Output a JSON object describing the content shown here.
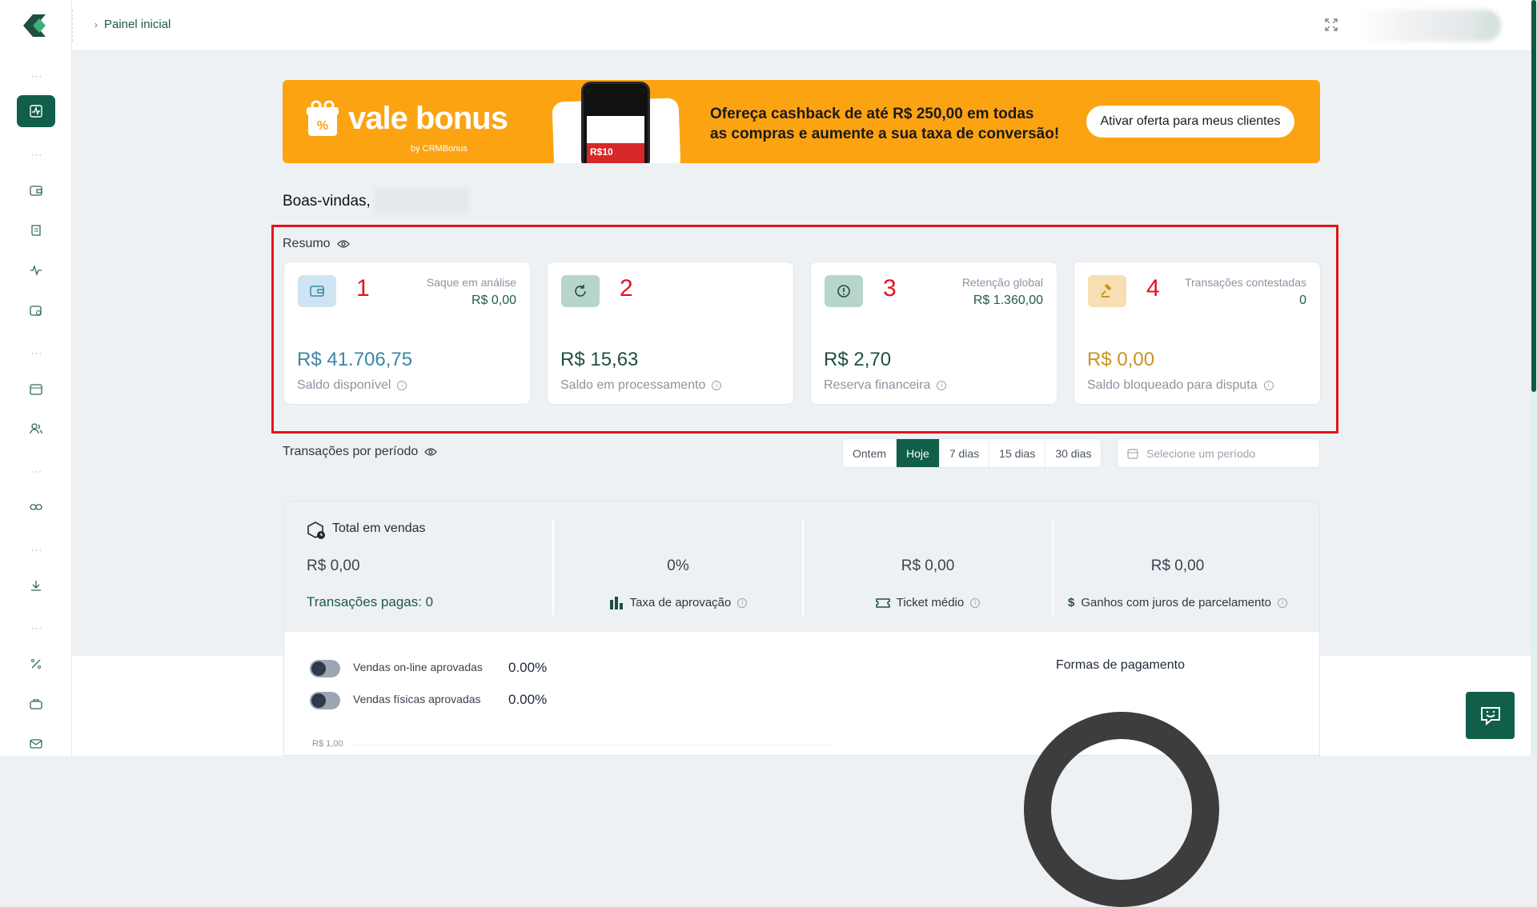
{
  "topbar": {
    "breadcrumb": "Painel inicial"
  },
  "banner": {
    "brand": "vale bonus",
    "brand_sub": "by CRMBonus",
    "phone_price": "R$10",
    "message_line1": "Ofereça cashback de até R$ 250,00 em todas",
    "message_line2": "as compras e aumente a sua taxa de conversão!",
    "cta": "Ativar oferta para meus clientes"
  },
  "welcome": {
    "text": "Boas-vindas,"
  },
  "resumo": {
    "title": "Resumo",
    "cards": [
      {
        "number": "1",
        "label": "Saque em análise",
        "sub": "R$ 0,00",
        "value": "R$ 41.706,75",
        "desc": "Saldo disponível",
        "value_color": "#3b86a8",
        "icon_bg": "#cfe4f2",
        "icon": "wallet-icon"
      },
      {
        "number": "2",
        "label": "",
        "sub": "",
        "value": "R$ 15,63",
        "desc": "Saldo em processamento",
        "value_color": "#1e4f40",
        "icon_bg": "#b7d6c9",
        "icon": "refresh-icon"
      },
      {
        "number": "3",
        "label": "Retenção global",
        "sub": "R$ 1.360,00",
        "value": "R$ 2,70",
        "desc": "Reserva financeira",
        "value_color": "#1e4f40",
        "icon_bg": "#b7d6c9",
        "icon": "alert-icon"
      },
      {
        "number": "4",
        "label": "Transações contestadas",
        "sub": "0",
        "value": "R$ 0,00",
        "desc": "Saldo bloqueado para disputa",
        "value_color": "#c9941c",
        "icon_bg": "#f6dfb2",
        "icon": "gavel-icon"
      }
    ]
  },
  "transactions": {
    "title": "Transações por período",
    "filters": [
      "Ontem",
      "Hoje",
      "7 dias",
      "15 dias",
      "30 dias"
    ],
    "active_filter": "Hoje",
    "date_placeholder": "Selecione um período"
  },
  "stats": {
    "total_title": "Total em vendas",
    "total_value": "R$ 0,00",
    "paid_transactions": "Transações pagas: 0",
    "approval_value": "0%",
    "approval_label": "Taxa de aprovação",
    "ticket_value": "R$ 0,00",
    "ticket_label": "Ticket médio",
    "interest_value": "R$ 0,00",
    "interest_label": "Ganhos com juros de parcelamento"
  },
  "sales": {
    "online_label": "Vendas on-line aprovadas",
    "online_value": "0.00%",
    "physical_label": "Vendas físicas aprovadas",
    "physical_value": "0.00%",
    "axis_top": "R$ 1,00",
    "payment_title": "Formas de pagamento"
  },
  "colors": {
    "brand": "#115e4b",
    "banner": "#fca311",
    "highlight": "#e3141d"
  }
}
